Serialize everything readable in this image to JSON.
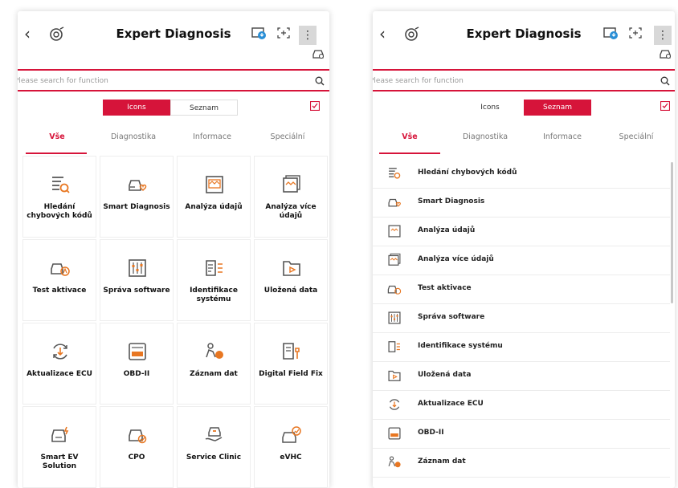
{
  "header": {
    "title": "Expert Diagnosis",
    "kebab_label": "⋮",
    "back_label": "‹"
  },
  "search": {
    "placeholder": "Please search for function"
  },
  "view_toggle": {
    "icons_label": "Icons",
    "list_label": "Seznam"
  },
  "tabs": [
    "Vše",
    "Diagnostika",
    "Informace",
    "Speciální"
  ],
  "functions": [
    {
      "label": "Hledání chybových kódů",
      "icon": "dtc-search-icon"
    },
    {
      "label": "Smart Diagnosis",
      "icon": "smart-diagnosis-icon"
    },
    {
      "label": "Analýza údajů",
      "icon": "data-analysis-icon"
    },
    {
      "label": "Analýza více údajů",
      "icon": "multi-data-analysis-icon"
    },
    {
      "label": "Test aktivace",
      "icon": "activation-test-icon"
    },
    {
      "label": "Správa software",
      "icon": "software-management-icon"
    },
    {
      "label": "Identifikace systému",
      "icon": "system-identification-icon"
    },
    {
      "label": "Uložená data",
      "icon": "saved-data-icon"
    },
    {
      "label": "Aktualizace ECU",
      "icon": "ecu-update-icon"
    },
    {
      "label": "OBD-II",
      "icon": "obd2-icon"
    },
    {
      "label": "Záznam dat",
      "icon": "data-record-icon"
    },
    {
      "label": "Digital Field Fix",
      "icon": "digital-field-fix-icon"
    },
    {
      "label": "Smart EV Solution",
      "icon": "smart-ev-icon"
    },
    {
      "label": "CPO",
      "icon": "cpo-icon"
    },
    {
      "label": "Service Clinic",
      "icon": "service-clinic-icon"
    },
    {
      "label": "eVHC",
      "icon": "evhc-icon"
    }
  ],
  "list_items": [
    "Hledání chybových kódů",
    "Smart Diagnosis",
    "Analýza údajů",
    "Analýza více údajů",
    "Test aktivace",
    "Správa software",
    "Identifikace systému",
    "Uložená data",
    "Aktualizace ECU",
    "OBD-II",
    "Záznam dat"
  ],
  "colors": {
    "accent": "#d6143a",
    "icon_orange": "#e87722",
    "icon_gray": "#555555"
  }
}
